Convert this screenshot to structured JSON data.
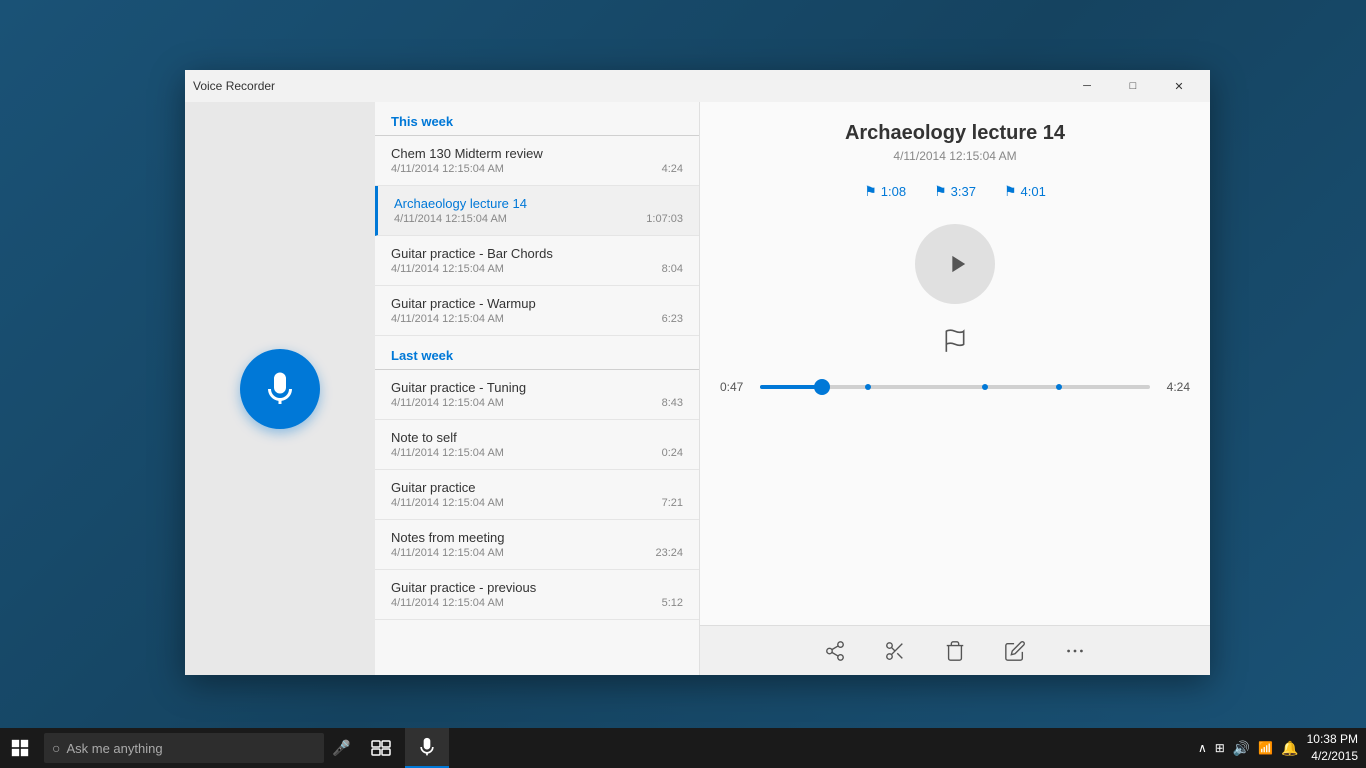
{
  "app": {
    "title": "Voice Recorder",
    "window": {
      "minimize_label": "─",
      "maximize_label": "□",
      "close_label": "✕"
    }
  },
  "sections": [
    {
      "id": "this_week",
      "label": "This week",
      "recordings": [
        {
          "name": "Chem 130 Midterm review",
          "date": "4/11/2014 12:15:04 AM",
          "duration": "4:24",
          "selected": false
        },
        {
          "name": "Archaeology lecture 14",
          "date": "4/11/2014 12:15:04 AM",
          "duration": "1:07:03",
          "selected": true
        },
        {
          "name": "Guitar practice - Bar Chords",
          "date": "4/11/2014 12:15:04 AM",
          "duration": "8:04",
          "selected": false
        },
        {
          "name": "Guitar practice - Warmup",
          "date": "4/11/2014 12:15:04 AM",
          "duration": "6:23",
          "selected": false
        }
      ]
    },
    {
      "id": "last_week",
      "label": "Last week",
      "recordings": [
        {
          "name": "Guitar practice - Tuning",
          "date": "4/11/2014 12:15:04 AM",
          "duration": "8:43",
          "selected": false
        },
        {
          "name": "Note to self",
          "date": "4/11/2014 12:15:04 AM",
          "duration": "0:24",
          "selected": false
        },
        {
          "name": "Guitar practice",
          "date": "4/11/2014 12:15:04 AM",
          "duration": "7:21",
          "selected": false
        },
        {
          "name": "Notes from meeting",
          "date": "4/11/2014 12:15:04 AM",
          "duration": "23:24",
          "selected": false
        },
        {
          "name": "Guitar practice - previous",
          "date": "4/11/2014 12:15:04 AM",
          "duration": "5:12",
          "selected": false
        }
      ]
    }
  ],
  "player": {
    "title": "Archaeology lecture 14",
    "date": "4/11/2014 12:15:04 AM",
    "markers": [
      {
        "time": "1:08"
      },
      {
        "time": "3:37"
      },
      {
        "time": "4:01"
      }
    ],
    "current_time": "0:47",
    "total_time": "4:24",
    "progress_percent": 16
  },
  "toolbar": {
    "share_title": "Share",
    "trim_title": "Trim",
    "delete_title": "Delete",
    "rename_title": "Rename",
    "more_title": "More"
  },
  "taskbar": {
    "search_placeholder": "Ask me anything",
    "time": "10:38 PM",
    "date": "4/2/2015"
  }
}
